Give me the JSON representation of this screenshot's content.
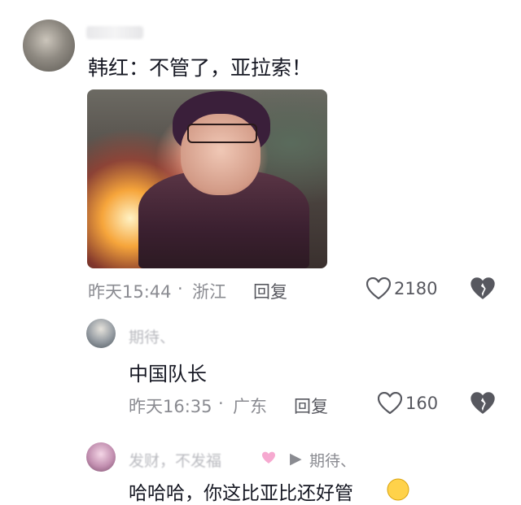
{
  "comment": {
    "text": "韩红：不管了，亚拉索！",
    "time": "昨天15:44",
    "separator": "·",
    "location": "浙江",
    "reply_label": "回复",
    "likes": "2180"
  },
  "reply1": {
    "author_partial": "期待、",
    "text": "中国队长",
    "time": "昨天16:35",
    "separator": "·",
    "location": "广东",
    "reply_label": "回复",
    "likes": "160"
  },
  "reply2": {
    "author_partial": "发财，不发福",
    "arrow": "▶",
    "to_name": "期待、",
    "text": "哈哈哈，你这比亚比还好管"
  },
  "icons": {
    "like": "heart-outline-icon",
    "dislike": "broken-heart-icon",
    "pink_heart": "pink-heart-emoji",
    "laugh": "laughing-face-emoji"
  },
  "colors": {
    "text": "#161823",
    "meta": "#8a8b91",
    "icon": "#57585f"
  }
}
